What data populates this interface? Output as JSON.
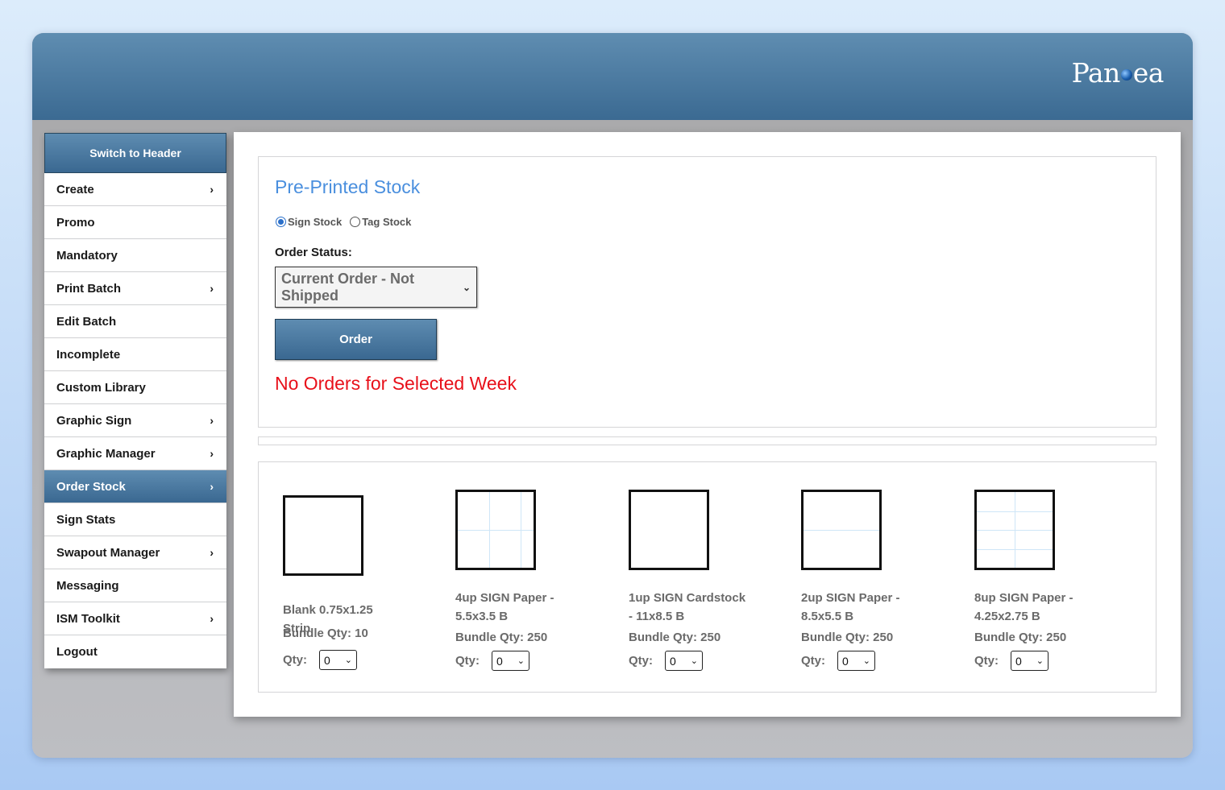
{
  "app": {
    "logo_text": "Pangea"
  },
  "sidebar": {
    "switch_label": "Switch to Header",
    "items": [
      {
        "label": "Create",
        "chevron": true
      },
      {
        "label": "Promo",
        "chevron": false
      },
      {
        "label": "Mandatory",
        "chevron": false
      },
      {
        "label": "Print Batch",
        "chevron": true
      },
      {
        "label": "Edit Batch",
        "chevron": false
      },
      {
        "label": "Incomplete",
        "chevron": false
      },
      {
        "label": "Custom Library",
        "chevron": false
      },
      {
        "label": "Graphic Sign",
        "chevron": true
      },
      {
        "label": "Graphic Manager",
        "chevron": true
      },
      {
        "label": "Order Stock",
        "chevron": true,
        "active": true
      },
      {
        "label": "Sign Stats",
        "chevron": false
      },
      {
        "label": "Swapout Manager",
        "chevron": true
      },
      {
        "label": "Messaging",
        "chevron": false
      },
      {
        "label": "ISM Toolkit",
        "chevron": true
      },
      {
        "label": "Logout",
        "chevron": false
      }
    ]
  },
  "order": {
    "title": "Pre-Printed Stock",
    "radio_sign": "Sign Stock",
    "radio_tag": "Tag Stock",
    "selected_radio": "Sign Stock",
    "status_label": "Order Status:",
    "status_value": "Current Order - Not Shipped",
    "order_button": "Order",
    "message": "No Orders for Selected Week"
  },
  "products": [
    {
      "name": "Blank 0.75x1.25 Strip",
      "bundle": "Bundle Qty: 10",
      "qty_label": "Qty:",
      "qty": "0",
      "grid": "none"
    },
    {
      "name": "4up SIGN Paper - 5.5x3.5 B",
      "bundle": "Bundle Qty: 250",
      "qty_label": "Qty:",
      "qty": "0",
      "grid": "4up"
    },
    {
      "name": "1up SIGN Cardstock - 11x8.5 B",
      "bundle": "Bundle Qty: 250",
      "qty_label": "Qty:",
      "qty": "0",
      "grid": "none"
    },
    {
      "name": "2up SIGN Paper - 8.5x5.5 B",
      "bundle": "Bundle Qty: 250",
      "qty_label": "Qty:",
      "qty": "0",
      "grid": "2up"
    },
    {
      "name": "8up SIGN Paper - 4.25x2.75 B",
      "bundle": "Bundle Qty: 250",
      "qty_label": "Qty:",
      "qty": "0",
      "grid": "8up"
    }
  ],
  "colors": {
    "accent": "#3a6891",
    "title": "#4a8fde",
    "error": "#e8101a"
  }
}
